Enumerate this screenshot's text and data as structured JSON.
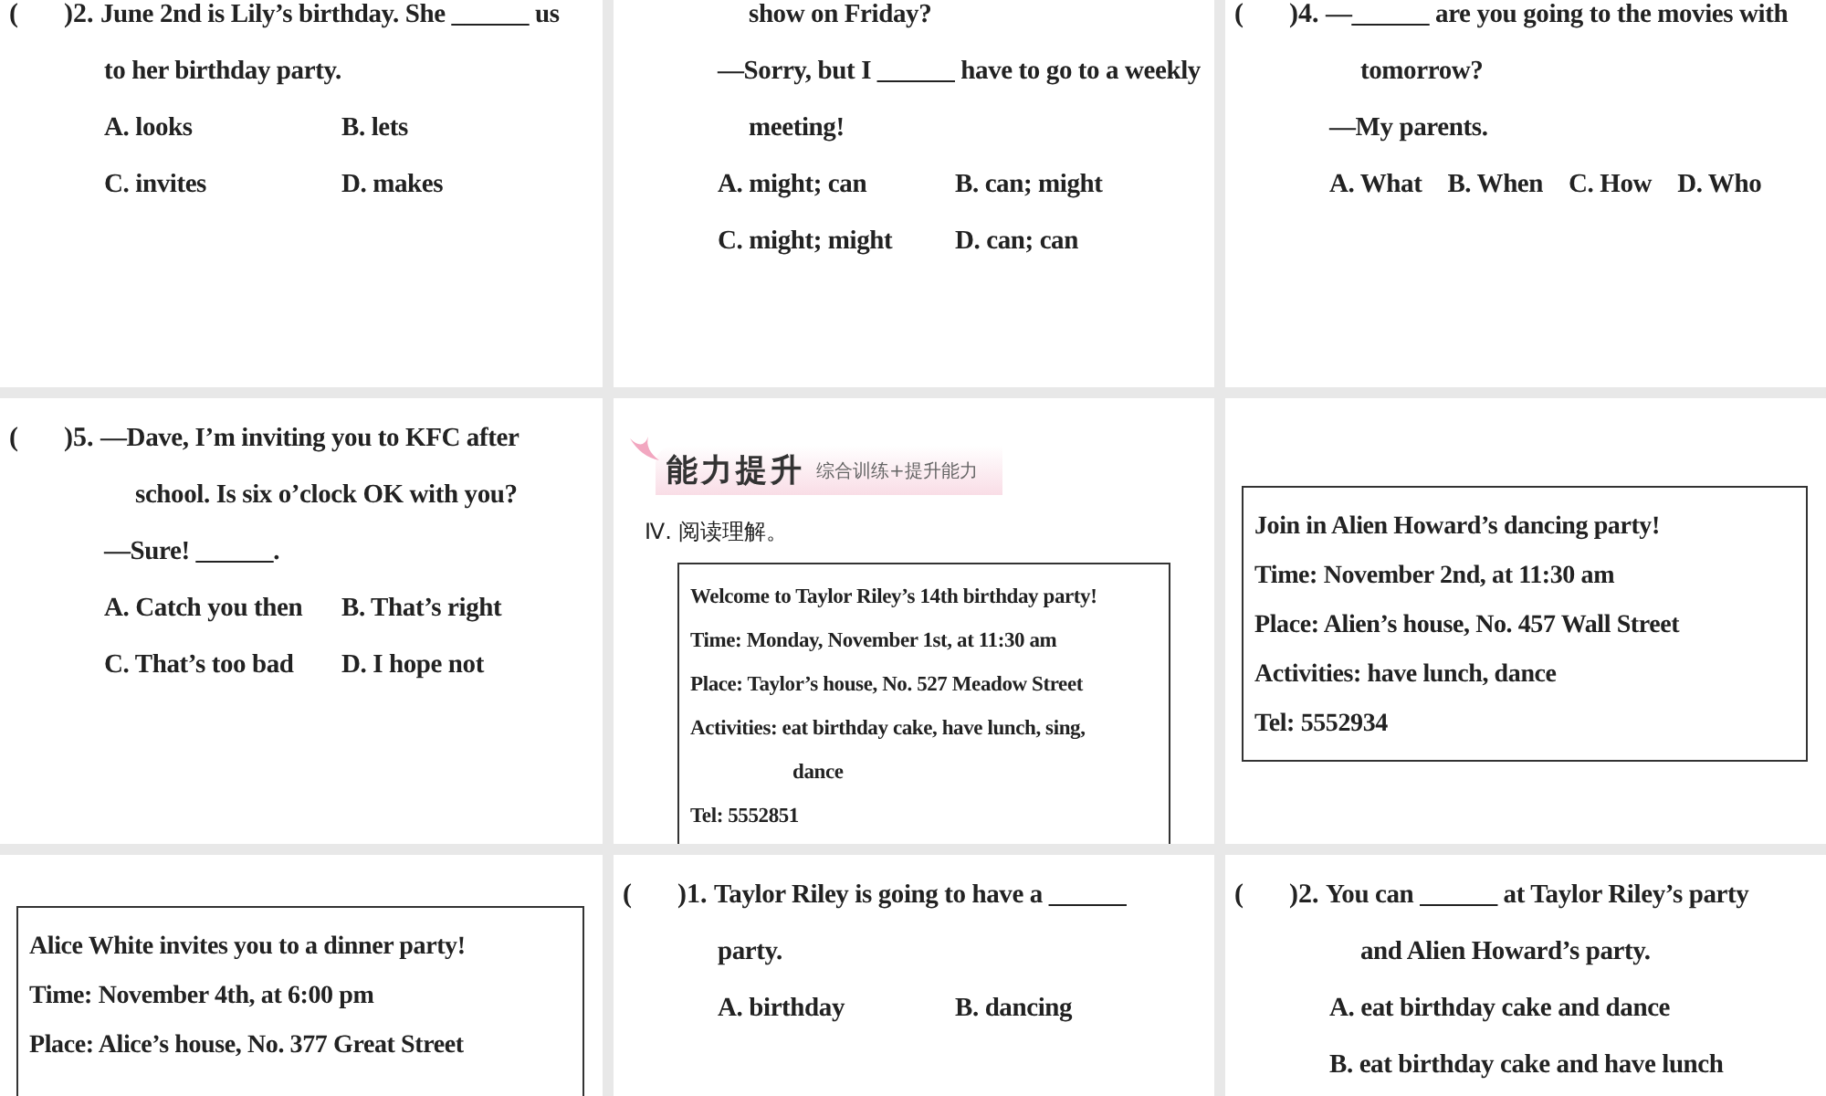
{
  "slides": [
    {
      "blocks": [
        {
          "kind": "question",
          "bracket": "(",
          "number": ")2.",
          "lines": [
            {
              "kind": "lead",
              "text": "June 2nd is Lily’s birthday. She ______ us"
            },
            {
              "kind": "base",
              "text": "to her birthday party."
            }
          ],
          "options": [
            [
              "A. looks",
              "B. lets"
            ],
            [
              "C. invites",
              "D. makes"
            ]
          ]
        }
      ]
    },
    {
      "blocks": [
        {
          "kind": "question",
          "lines": [
            {
              "kind": "hang",
              "text": "show on Friday?"
            },
            {
              "kind": "base",
              "text": "—Sorry, but I ______ have to go to a weekly"
            },
            {
              "kind": "hang",
              "text": "meeting!"
            }
          ],
          "options": [
            [
              "A. might; can",
              "B. can; might"
            ],
            [
              "C. might; might",
              "D. can; can"
            ]
          ]
        }
      ]
    },
    {
      "blocks": [
        {
          "kind": "question",
          "bracket": "(",
          "number": ")4.",
          "lines": [
            {
              "kind": "lead",
              "text": "—______ are you going to the movies with"
            },
            {
              "kind": "hang",
              "text": "tomorrow?"
            },
            {
              "kind": "base",
              "text": "—My parents."
            }
          ],
          "options": [
            [
              "A. What",
              "B. When",
              "C. How",
              "D. Who"
            ]
          ]
        }
      ]
    },
    {
      "blocks": [
        {
          "kind": "question",
          "bracket": "(",
          "number": ")5.",
          "lines": [
            {
              "kind": "lead",
              "text": "—Dave, I’m inviting you to KFC after"
            },
            {
              "kind": "hang",
              "text": "school. Is six o’clock OK with you?"
            },
            {
              "kind": "base",
              "text": "—Sure! ______."
            }
          ],
          "options": [
            [
              "A. Catch you then",
              "B. That’s right"
            ],
            [
              "C. That’s too bad",
              "D. I hope not"
            ]
          ]
        }
      ]
    },
    {
      "blocks": [
        {
          "kind": "banner",
          "title": "能力提升",
          "subtitle": "综合训练+提升能力"
        },
        {
          "kind": "section",
          "text": "Ⅳ. 阅读理解。"
        },
        {
          "kind": "insetnotice",
          "closed": false,
          "lines": [
            {
              "kind": "base",
              "text": "Welcome to Taylor Riley’s 14th birthday party!"
            },
            {
              "kind": "base",
              "text": "Time: Monday, November 1st, at 11:30 am"
            },
            {
              "kind": "base",
              "text": "Place: Taylor’s house, No. 527 Meadow Street"
            },
            {
              "kind": "base",
              "text": "Activities: eat birthday cake, have lunch, sing,"
            },
            {
              "kind": "hang",
              "text": "dance"
            },
            {
              "kind": "base",
              "text": "Tel: 5552851"
            }
          ]
        }
      ]
    },
    {
      "blocks": [
        {
          "kind": "notice",
          "closed": true,
          "lines": [
            {
              "kind": "base",
              "text": "Join in Alien Howard’s dancing party!"
            },
            {
              "kind": "base",
              "text": "Time: November 2nd, at 11:30 am"
            },
            {
              "kind": "base",
              "text": "Place: Alien’s house, No. 457 Wall Street"
            },
            {
              "kind": "base",
              "text": "Activities: have lunch, dance"
            },
            {
              "kind": "base",
              "text": "Tel: 5552934"
            }
          ]
        }
      ]
    },
    {
      "blocks": [
        {
          "kind": "notice",
          "closed": false,
          "lines": [
            {
              "kind": "base",
              "text": "Alice White invites you to a dinner party!"
            },
            {
              "kind": "base",
              "text": "Time: November 4th, at 6:00 pm"
            },
            {
              "kind": "base",
              "text": "Place: Alice’s house, No. 377 Great Street"
            }
          ]
        }
      ]
    },
    {
      "blocks": [
        {
          "kind": "question",
          "bracket": "(",
          "number": ")1.",
          "lines": [
            {
              "kind": "lead",
              "text": "Taylor Riley is going to have a ______"
            },
            {
              "kind": "base",
              "text": "party."
            }
          ],
          "options": [
            [
              "A. birthday",
              "B. dancing"
            ]
          ]
        }
      ]
    },
    {
      "blocks": [
        {
          "kind": "question",
          "bracket": "(",
          "number": ")2.",
          "lines": [
            {
              "kind": "lead",
              "text": "You can ______ at Taylor Riley’s party"
            },
            {
              "kind": "hang",
              "text": "and Alien Howard’s party."
            }
          ],
          "options": [
            [
              "A. eat birthday cake and dance"
            ],
            [
              "B. eat birthday cake and have lunch"
            ]
          ]
        }
      ]
    }
  ]
}
